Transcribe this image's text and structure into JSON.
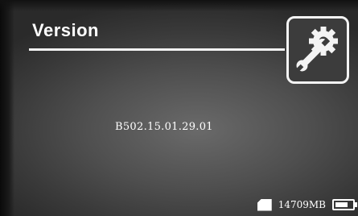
{
  "header": {
    "title": "Version"
  },
  "icons": {
    "settings": "wrench-gear-icon",
    "storage": "sd-card-icon",
    "battery": "battery-icon"
  },
  "content": {
    "version_value": "B502.15.01.29.01"
  },
  "status_bar": {
    "memory": "14709MB",
    "battery_level": 0.75
  }
}
